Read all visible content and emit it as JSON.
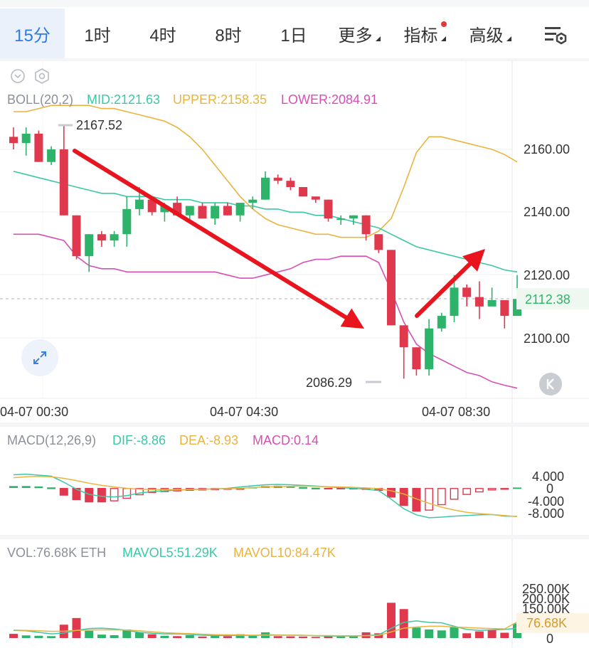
{
  "tabs": [
    {
      "label": "15分",
      "active": true
    },
    {
      "label": "1时"
    },
    {
      "label": "4时"
    },
    {
      "label": "8时"
    },
    {
      "label": "1日"
    },
    {
      "label": "更多",
      "dropdown": true
    },
    {
      "label": "指标",
      "dropdown": true,
      "dot": true
    },
    {
      "label": "高级",
      "dropdown": true
    }
  ],
  "icons": {
    "settings": "chart-settings-icon",
    "collapse": "chevron-down-circle-icon",
    "gear": "hexagon-gear-icon",
    "expand": "expand-arrows-icon",
    "reset": "k-reset-icon"
  },
  "colors": {
    "up": "#2eb46a",
    "down": "#e0394e",
    "mid": "#3cc8a6",
    "upper": "#e9b43f",
    "lower": "#d74fb4",
    "accent": "#2f7be5",
    "arrow": "#e8141e"
  },
  "main": {
    "boll_name": "BOLL(20,2)",
    "mid_label": "MID:2121.63",
    "upper_label": "UPPER:2158.35",
    "lower_label": "LOWER:2084.91",
    "high_label": "2167.52",
    "low_label": "2086.29",
    "last_price": "2112.38",
    "price_ticks": [
      "2160.00",
      "2140.00",
      "2120.00",
      "2100.00"
    ],
    "time_labels": [
      "04-07 00:30",
      "04-07 04:30",
      "04-07 08:30"
    ]
  },
  "macd": {
    "name": "MACD(12,26,9)",
    "dif_label": "DIF:-8.86",
    "dea_label": "DEA:-8.93",
    "macd_label": "MACD:0.14",
    "ticks": [
      "4.000",
      "0",
      "-4.000",
      "-8.000"
    ]
  },
  "vol": {
    "vol_label": "VOL:76.68K ETH",
    "mavol5_label": "MAVOL5:51.29K",
    "mavol10_label": "MAVOL10:84.47K",
    "last_label": "76.68K",
    "ticks": [
      "250.00K",
      "200.00K",
      "150.00K",
      "0"
    ]
  },
  "chart_data": {
    "type": "candlestick",
    "price_axis": [
      2080,
      2175
    ],
    "candles": [
      {
        "o": 2164,
        "h": 2167,
        "l": 2160,
        "c": 2162
      },
      {
        "o": 2162,
        "h": 2167,
        "l": 2158,
        "c": 2165
      },
      {
        "o": 2165,
        "h": 2166,
        "l": 2156,
        "c": 2156
      },
      {
        "o": 2156,
        "h": 2161,
        "l": 2155,
        "c": 2160
      },
      {
        "o": 2160,
        "h": 2167.52,
        "l": 2139,
        "c": 2139
      },
      {
        "o": 2139,
        "h": 2139,
        "l": 2125,
        "c": 2126
      },
      {
        "o": 2126,
        "h": 2133,
        "l": 2121,
        "c": 2133
      },
      {
        "o": 2133,
        "h": 2134,
        "l": 2129,
        "c": 2131
      },
      {
        "o": 2131,
        "h": 2134,
        "l": 2129,
        "c": 2133
      },
      {
        "o": 2133,
        "h": 2145,
        "l": 2129,
        "c": 2141
      },
      {
        "o": 2141,
        "h": 2148,
        "l": 2139,
        "c": 2144
      },
      {
        "o": 2144,
        "h": 2145,
        "l": 2139,
        "c": 2140
      },
      {
        "o": 2140,
        "h": 2143,
        "l": 2137,
        "c": 2142
      },
      {
        "o": 2143,
        "h": 2145,
        "l": 2139,
        "c": 2139
      },
      {
        "o": 2139,
        "h": 2142,
        "l": 2137,
        "c": 2142
      },
      {
        "o": 2142,
        "h": 2143,
        "l": 2138,
        "c": 2138
      },
      {
        "o": 2138,
        "h": 2143,
        "l": 2136,
        "c": 2142
      },
      {
        "o": 2142,
        "h": 2143,
        "l": 2139,
        "c": 2139
      },
      {
        "o": 2139,
        "h": 2143,
        "l": 2137,
        "c": 2143
      },
      {
        "o": 2143,
        "h": 2145,
        "l": 2141,
        "c": 2144
      },
      {
        "o": 2144,
        "h": 2153,
        "l": 2144,
        "c": 2151
      },
      {
        "o": 2151,
        "h": 2152,
        "l": 2149,
        "c": 2150
      },
      {
        "o": 2150,
        "h": 2151,
        "l": 2147,
        "c": 2148
      },
      {
        "o": 2148,
        "h": 2148,
        "l": 2145,
        "c": 2145
      },
      {
        "o": 2145,
        "h": 2145,
        "l": 2143,
        "c": 2144
      },
      {
        "o": 2144,
        "h": 2144,
        "l": 2137,
        "c": 2138
      },
      {
        "o": 2138,
        "h": 2139,
        "l": 2136,
        "c": 2138
      },
      {
        "o": 2138,
        "h": 2139,
        "l": 2136,
        "c": 2139
      },
      {
        "o": 2139,
        "h": 2139,
        "l": 2131,
        "c": 2133
      },
      {
        "o": 2133,
        "h": 2133,
        "l": 2127,
        "c": 2128
      },
      {
        "o": 2128,
        "h": 2128,
        "l": 2104,
        "c": 2104
      },
      {
        "o": 2104,
        "h": 2104,
        "l": 2087,
        "c": 2097
      },
      {
        "o": 2097,
        "h": 2097,
        "l": 2088,
        "c": 2090
      },
      {
        "o": 2090,
        "h": 2106,
        "l": 2088,
        "c": 2103
      },
      {
        "o": 2103,
        "h": 2108,
        "l": 2102,
        "c": 2107
      },
      {
        "o": 2107,
        "h": 2120,
        "l": 2105,
        "c": 2116
      },
      {
        "o": 2116,
        "h": 2117,
        "l": 2110,
        "c": 2113
      },
      {
        "o": 2113,
        "h": 2118,
        "l": 2106,
        "c": 2110
      },
      {
        "o": 2110,
        "h": 2116,
        "l": 2110,
        "c": 2112
      },
      {
        "o": 2112,
        "h": 2112,
        "l": 2103,
        "c": 2107
      },
      {
        "o": 2107,
        "h": 2120,
        "l": 2107,
        "c": 2112.38
      }
    ],
    "boll_upper": [
      2172,
      2172,
      2173,
      2174,
      2174,
      2174,
      2174,
      2173,
      2173,
      2172,
      2171,
      2170,
      2169,
      2167,
      2164,
      2160,
      2155,
      2150,
      2145,
      2141,
      2138,
      2136,
      2135,
      2134,
      2133,
      2133,
      2132,
      2132,
      2132,
      2134,
      2138,
      2148,
      2159,
      2164,
      2164,
      2163,
      2162,
      2161,
      2160,
      2158.35,
      2156
    ],
    "boll_mid": [
      2153,
      2152,
      2151,
      2150,
      2149,
      2148,
      2147,
      2146,
      2146,
      2145,
      2145,
      2145,
      2144,
      2144,
      2144,
      2143,
      2143,
      2143,
      2142,
      2142,
      2141,
      2141,
      2140,
      2140,
      2139,
      2139,
      2138,
      2137,
      2136,
      2135,
      2133,
      2131,
      2129,
      2128,
      2127,
      2126,
      2125,
      2124,
      2123,
      2121.63,
      2121
    ],
    "boll_lower": [
      2133,
      2133,
      2133,
      2132,
      2131,
      2126,
      2123,
      2122,
      2122,
      2121,
      2121,
      2121,
      2121,
      2121,
      2121,
      2121,
      2121,
      2120,
      2119,
      2119,
      2120,
      2121,
      2122,
      2124,
      2125,
      2125,
      2126,
      2126,
      2126,
      2124,
      2115,
      2105,
      2098,
      2095,
      2093,
      2091,
      2089,
      2088,
      2086,
      2084.91,
      2084
    ],
    "macd_axis": [
      -10,
      7
    ],
    "macd_hist": [
      0.6,
      0.6,
      0.5,
      0.2,
      -2.4,
      -3.8,
      -4.5,
      -4.5,
      -4.2,
      -3.4,
      -2.3,
      -1.6,
      -1.3,
      -1.1,
      -0.9,
      -0.8,
      -0.7,
      -0.4,
      -0.1,
      0.3,
      0.6,
      0.7,
      0.6,
      0.3,
      0.1,
      -0.2,
      -0.3,
      -0.3,
      -0.6,
      -0.9,
      -3.0,
      -5.6,
      -7.4,
      -7.1,
      -5.4,
      -3.7,
      -2.2,
      -1.4,
      -0.8,
      -0.4,
      0.14
    ],
    "macd_dif": [
      4.1,
      4.3,
      4.0,
      3.7,
      1.8,
      -0.4,
      -2.0,
      -2.6,
      -2.8,
      -2.4,
      -1.6,
      -1.1,
      -0.9,
      -0.7,
      -0.5,
      -0.4,
      -0.3,
      -0.1,
      0.3,
      0.7,
      1.0,
      1.1,
      1.0,
      0.8,
      0.6,
      0.3,
      0.1,
      -0.1,
      -0.4,
      -0.8,
      -3.5,
      -6.5,
      -8.4,
      -9.3,
      -9.1,
      -8.8,
      -8.6,
      -8.4,
      -8.3,
      -8.8,
      -8.86
    ],
    "macd_dea": [
      3.2,
      3.5,
      3.6,
      3.5,
      3.0,
      2.3,
      1.5,
      0.8,
      0.3,
      -0.1,
      -0.4,
      -0.5,
      -0.5,
      -0.5,
      -0.5,
      -0.4,
      -0.3,
      -0.2,
      -0.1,
      0.1,
      0.3,
      0.4,
      0.5,
      0.6,
      0.5,
      0.4,
      0.3,
      0.2,
      0.0,
      -0.2,
      -0.9,
      -1.9,
      -3.4,
      -4.8,
      -6.0,
      -6.9,
      -7.6,
      -8.0,
      -8.3,
      -8.6,
      -8.93
    ],
    "vol_axis": [
      0,
      280
    ],
    "volume": [
      {
        "v": 22,
        "up": false
      },
      {
        "v": 14,
        "up": true
      },
      {
        "v": 12,
        "up": true
      },
      {
        "v": 10,
        "up": true
      },
      {
        "v": 70,
        "up": false
      },
      {
        "v": 105,
        "up": false
      },
      {
        "v": 38,
        "up": true
      },
      {
        "v": 18,
        "up": true
      },
      {
        "v": 15,
        "up": true
      },
      {
        "v": 45,
        "up": true
      },
      {
        "v": 30,
        "up": true
      },
      {
        "v": 20,
        "up": false
      },
      {
        "v": 12,
        "up": true
      },
      {
        "v": 10,
        "up": false
      },
      {
        "v": 15,
        "up": true
      },
      {
        "v": 8,
        "up": false
      },
      {
        "v": 18,
        "up": true
      },
      {
        "v": 10,
        "up": false
      },
      {
        "v": 20,
        "up": true
      },
      {
        "v": 12,
        "up": true
      },
      {
        "v": 30,
        "up": true
      },
      {
        "v": 10,
        "up": false
      },
      {
        "v": 9,
        "up": false
      },
      {
        "v": 8,
        "up": false
      },
      {
        "v": 6,
        "up": false
      },
      {
        "v": 15,
        "up": false
      },
      {
        "v": 8,
        "up": true
      },
      {
        "v": 10,
        "up": true
      },
      {
        "v": 30,
        "up": false
      },
      {
        "v": 25,
        "up": false
      },
      {
        "v": 185,
        "up": false
      },
      {
        "v": 152,
        "up": false
      },
      {
        "v": 55,
        "up": true
      },
      {
        "v": 45,
        "up": true
      },
      {
        "v": 40,
        "up": true
      },
      {
        "v": 60,
        "up": true
      },
      {
        "v": 25,
        "up": false
      },
      {
        "v": 35,
        "up": false
      },
      {
        "v": 45,
        "up": false
      },
      {
        "v": 28,
        "up": false
      },
      {
        "v": 76.68,
        "up": true
      }
    ],
    "mavol5": [
      40,
      38,
      30,
      22,
      26,
      40,
      50,
      52,
      48,
      40,
      30,
      25,
      22,
      22,
      19,
      15,
      13,
      13,
      14,
      13,
      17,
      16,
      15,
      15,
      12,
      10,
      10,
      10,
      13,
      17,
      51,
      82,
      90,
      82,
      80,
      62,
      45,
      40,
      43,
      45,
      51.29
    ],
    "mavol10": [
      42,
      40,
      38,
      35,
      36,
      40,
      42,
      43,
      43,
      42,
      38,
      33,
      28,
      25,
      23,
      20,
      18,
      17,
      16,
      15,
      15,
      15,
      15,
      14,
      13,
      13,
      12,
      12,
      12,
      14,
      32,
      52,
      58,
      62,
      62,
      58,
      55,
      52,
      50,
      48,
      84.47
    ]
  }
}
